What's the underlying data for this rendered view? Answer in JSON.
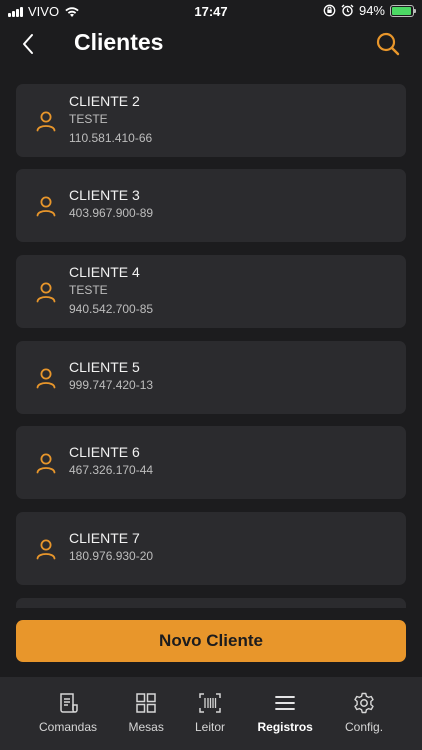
{
  "status_bar": {
    "carrier": "VIVO",
    "time": "17:47",
    "battery": "94%",
    "battery_level": 0.94
  },
  "header": {
    "title": "Clientes"
  },
  "clients": [
    {
      "name": "CLIENTE 2",
      "lines": [
        "TESTE",
        "110.581.410-66"
      ]
    },
    {
      "name": "CLIENTE 3",
      "lines": [
        "403.967.900-89"
      ]
    },
    {
      "name": "CLIENTE 4",
      "lines": [
        "TESTE",
        "940.542.700-85"
      ]
    },
    {
      "name": "CLIENTE 5",
      "lines": [
        "999.747.420-13"
      ]
    },
    {
      "name": "CLIENTE 6",
      "lines": [
        "467.326.170-44"
      ]
    },
    {
      "name": "CLIENTE 7",
      "lines": [
        "180.976.930-20"
      ]
    }
  ],
  "new_client_label": "Novo Cliente",
  "tabs": [
    {
      "label": "Comandas",
      "icon": "receipt-icon"
    },
    {
      "label": "Mesas",
      "icon": "grid-icon"
    },
    {
      "label": "Leitor",
      "icon": "barcode-icon"
    },
    {
      "label": "Registros",
      "icon": "menu-icon",
      "active": true
    },
    {
      "label": "Config.",
      "icon": "gear-icon"
    }
  ],
  "colors": {
    "accent": "#e8962b",
    "background": "#1c1c1e",
    "card": "#2b2b2e"
  }
}
